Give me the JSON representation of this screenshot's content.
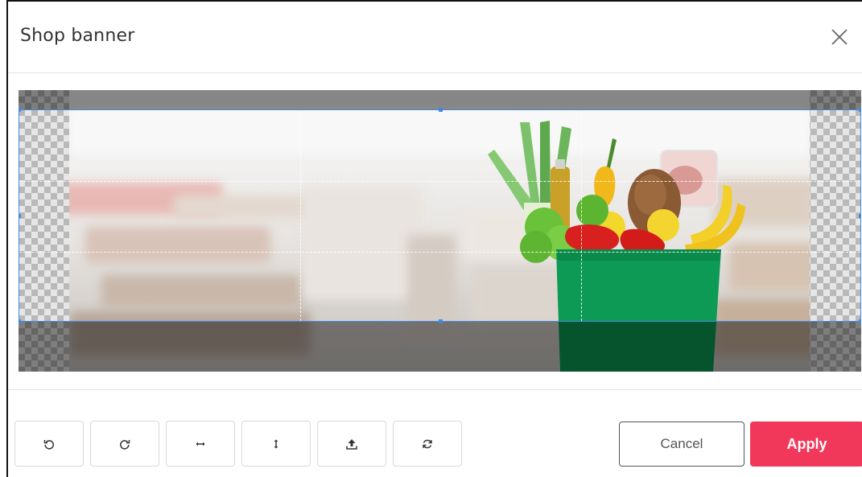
{
  "dialog": {
    "title": "Shop banner"
  },
  "icons": {
    "close": "close-icon",
    "rotate_left": "rotate-left-icon",
    "rotate_right": "rotate-right-icon",
    "flip_horizontal": "flip-horizontal-icon",
    "flip_vertical": "flip-vertical-icon",
    "upload": "upload-icon",
    "reset": "reset-icon"
  },
  "toolbar": {
    "items": [
      "rotate-left",
      "rotate-right",
      "flip-horizontal",
      "flip-vertical",
      "upload",
      "reset"
    ]
  },
  "actions": {
    "cancel_label": "Cancel",
    "apply_label": "Apply"
  },
  "colors": {
    "accent": "#f2385a",
    "crop_border": "#3f8ae6",
    "bag": "#0c9a55"
  }
}
